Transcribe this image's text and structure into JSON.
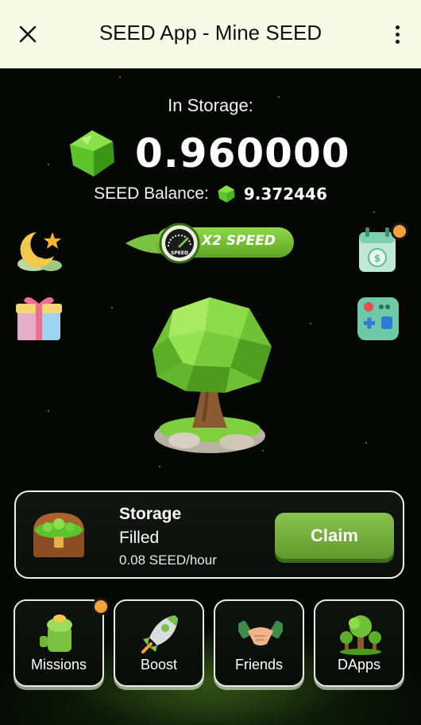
{
  "header": {
    "title": "SEED App - Mine SEED",
    "close_icon": "close-icon",
    "menu_icon": "more-vertical-icon"
  },
  "storage": {
    "label": "In Storage:",
    "value": "0.960000",
    "icon": "green-gem-icon"
  },
  "balance": {
    "label": "SEED Balance:",
    "value": "9.372446",
    "icon": "green-gem-icon"
  },
  "speed_badge": {
    "label": "X2 SPEED",
    "gauge_label": "SPEED",
    "icon": "speedometer-icon"
  },
  "side_icons": {
    "left_top": "moon-star-icon",
    "left_bottom": "gift-box-icon",
    "right_top": "calendar-coin-icon",
    "right_bottom": "game-controller-icon"
  },
  "tree": {
    "icon": "seed-tree-icon"
  },
  "storage_card": {
    "title": "Storage",
    "status": "Filled",
    "rate": "0.08 SEED/hour",
    "claim_label": "Claim",
    "icon": "treasure-chest-icon"
  },
  "nav": [
    {
      "label": "Missions",
      "icon": "missions-icon",
      "has_notification": true
    },
    {
      "label": "Boost",
      "icon": "rocket-icon",
      "has_notification": false
    },
    {
      "label": "Friends",
      "icon": "handshake-icon",
      "has_notification": false
    },
    {
      "label": "DApps",
      "icon": "trees-icon",
      "has_notification": false
    }
  ],
  "colors": {
    "header_bg": "#f6fae6",
    "background": "#040704",
    "accent_green": "#7cc242",
    "notification": "#f5a23a"
  }
}
